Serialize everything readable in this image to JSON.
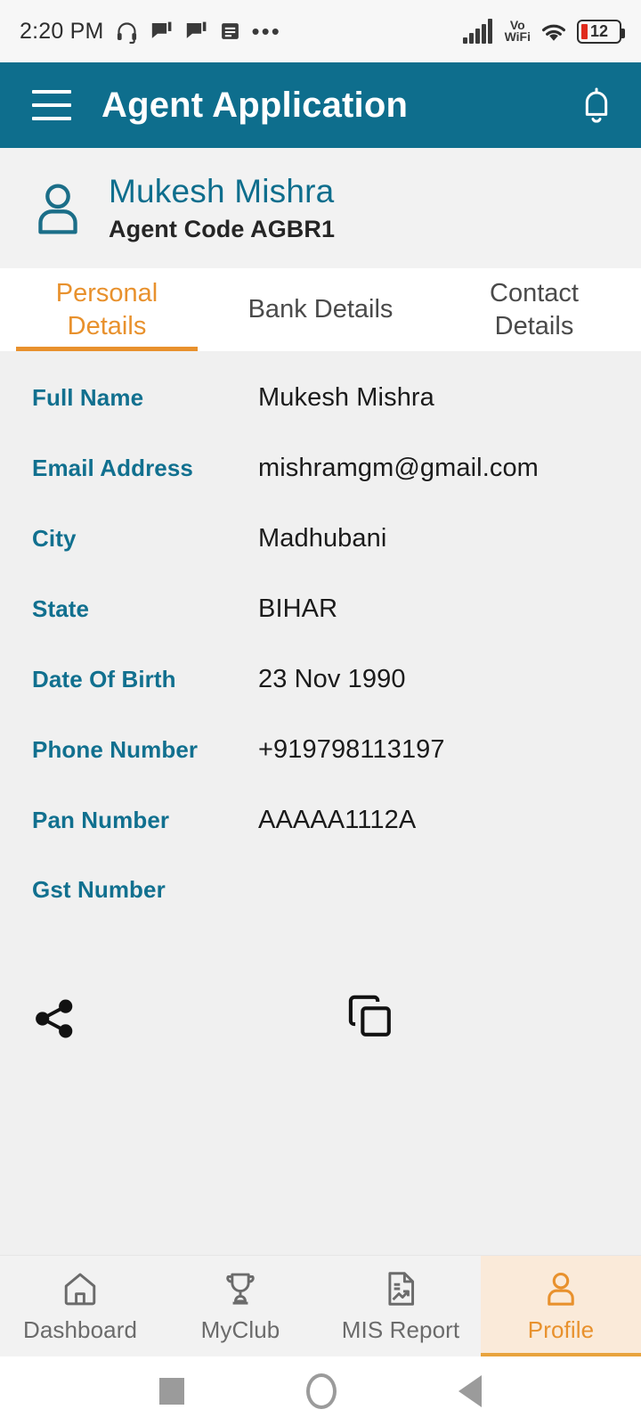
{
  "status_bar": {
    "time": "2:20 PM",
    "icons": [
      "headphone-icon",
      "chat-bubble-icon",
      "chat-bubble-icon",
      "note-icon",
      "overflow-dots-icon"
    ],
    "network_label": "Vo",
    "network_label2": "WiFi",
    "battery_level": "12"
  },
  "app_bar": {
    "title": "Agent Application",
    "menu_icon": "hamburger-menu-icon",
    "notification_icon": "bell-icon"
  },
  "profile": {
    "avatar_icon": "person-icon",
    "name": "Mukesh Mishra",
    "agent_code": "Agent Code AGBR1"
  },
  "tabs": [
    {
      "label": "Personal Details",
      "active": true
    },
    {
      "label": "Bank Details",
      "active": false
    },
    {
      "label": "Contact Details",
      "active": false
    }
  ],
  "details": [
    {
      "label": "Full Name",
      "value": "Mukesh Mishra"
    },
    {
      "label": "Email Address",
      "value": "mishramgm@gmail.com"
    },
    {
      "label": "City",
      "value": "Madhubani"
    },
    {
      "label": "State",
      "value": "BIHAR"
    },
    {
      "label": "Date Of Birth",
      "value": "23 Nov 1990"
    },
    {
      "label": "Phone Number",
      "value": "+919798113197"
    },
    {
      "label": "Pan Number",
      "value": "AAAAA1112A"
    },
    {
      "label": "Gst Number",
      "value": ""
    }
  ],
  "actions": [
    {
      "name": "share-icon"
    },
    {
      "name": "copy-icon"
    }
  ],
  "bottom_nav": [
    {
      "label": "Dashboard",
      "icon": "home-icon",
      "active": false
    },
    {
      "label": "MyClub",
      "icon": "trophy-icon",
      "active": false
    },
    {
      "label": "MIS Report",
      "icon": "report-icon",
      "active": false
    },
    {
      "label": "Profile",
      "icon": "person-icon",
      "active": true
    }
  ],
  "android_nav": [
    {
      "name": "recents-button"
    },
    {
      "name": "home-button"
    },
    {
      "name": "back-button"
    }
  ],
  "colors": {
    "primary_teal": "#0e6e8d",
    "label_teal": "#11708f",
    "accent_orange": "#e8912d",
    "active_tab_bg": "#faead9",
    "body_bg": "#f0f0f0",
    "battery_red": "#e02b1d"
  }
}
